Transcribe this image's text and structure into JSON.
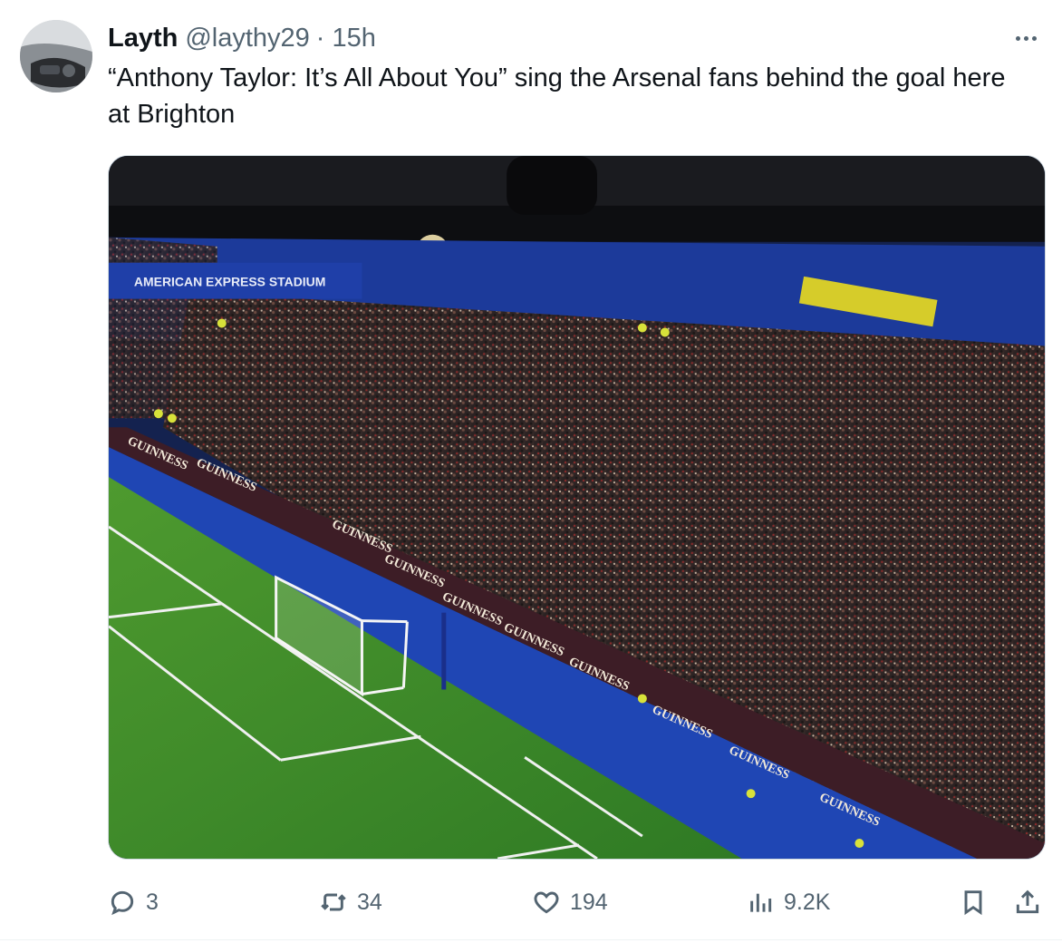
{
  "tweet": {
    "author_name": "Layth",
    "handle": "@laythy29",
    "separator": "·",
    "time": "15h",
    "text": "“Anthony Taylor: It’s All About You” sing the Arsenal fans behind the goal here at Brighton"
  },
  "media": {
    "signage": {
      "stadium_board": "AMERICAN EXPRESS STADIUM",
      "ad_boards": [
        "GUINNESS",
        "GUINNESS",
        "GUINNESS",
        "GUINNESS",
        "GUINNESS",
        "GUINNESS",
        "GUINNESS",
        "GUINNESS",
        "GUINNESS",
        "GUINNESS"
      ]
    }
  },
  "actions": {
    "replies": "3",
    "retweets": "34",
    "likes": "194",
    "views": "9.2K"
  },
  "icons": {
    "more": "more-icon",
    "reply": "reply-icon",
    "retweet": "retweet-icon",
    "like": "heart-icon",
    "views": "views-icon",
    "bookmark": "bookmark-icon",
    "share": "share-icon"
  },
  "colors": {
    "text": "#0f1419",
    "secondary": "#536471",
    "border": "#cfd9de",
    "pitch": "#3f8f2c",
    "apron": "#1f46b4",
    "stand": "#1a2a6e"
  }
}
